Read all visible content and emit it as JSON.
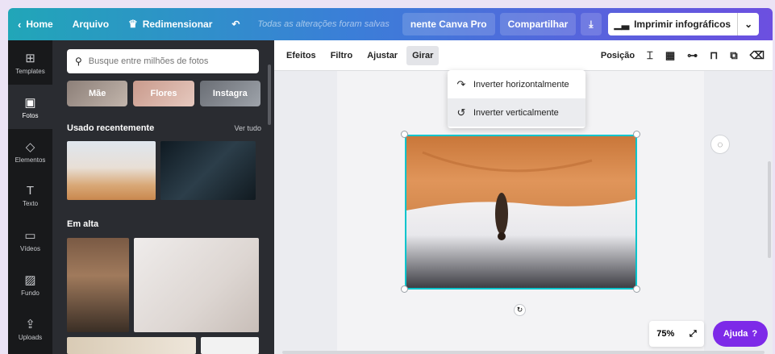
{
  "topbar": {
    "home_label": "Home",
    "file_label": "Arquivo",
    "resize_label": "Redimensionar",
    "status_text": "Todas as alterações foram salvas",
    "pro_label": "nente Canva Pro",
    "share_label": "Compartilhar",
    "print_label": "Imprimir infográficos"
  },
  "rail": {
    "items": [
      {
        "label": "Templates",
        "icon": "templates-icon"
      },
      {
        "label": "Fotos",
        "icon": "photos-icon"
      },
      {
        "label": "Elementos",
        "icon": "elements-icon"
      },
      {
        "label": "Texto",
        "icon": "text-icon"
      },
      {
        "label": "Vídeos",
        "icon": "video-icon"
      },
      {
        "label": "Fundo",
        "icon": "background-icon"
      },
      {
        "label": "Uploads",
        "icon": "upload-icon"
      }
    ]
  },
  "panel": {
    "search_placeholder": "Busque entre milhões de fotos",
    "chips": [
      "Mãe",
      "Flores",
      "Instagra"
    ],
    "recent_title": "Usado recentemente",
    "see_all": "Ver tudo",
    "trending_title": "Em alta"
  },
  "toolbar": {
    "effects": "Efeitos",
    "filter": "Filtro",
    "adjust": "Ajustar",
    "rotate": "Girar",
    "position": "Posição"
  },
  "flip_menu": {
    "horizontal": "Inverter horizontalmente",
    "vertical": "Inverter verticalmente"
  },
  "zoom": {
    "value": "75%"
  },
  "help": {
    "label": "Ajuda",
    "mark": "?"
  },
  "colors": {
    "accent": "#7d2ae8",
    "selection": "#00c4cc",
    "sidebar": "#18191b"
  }
}
